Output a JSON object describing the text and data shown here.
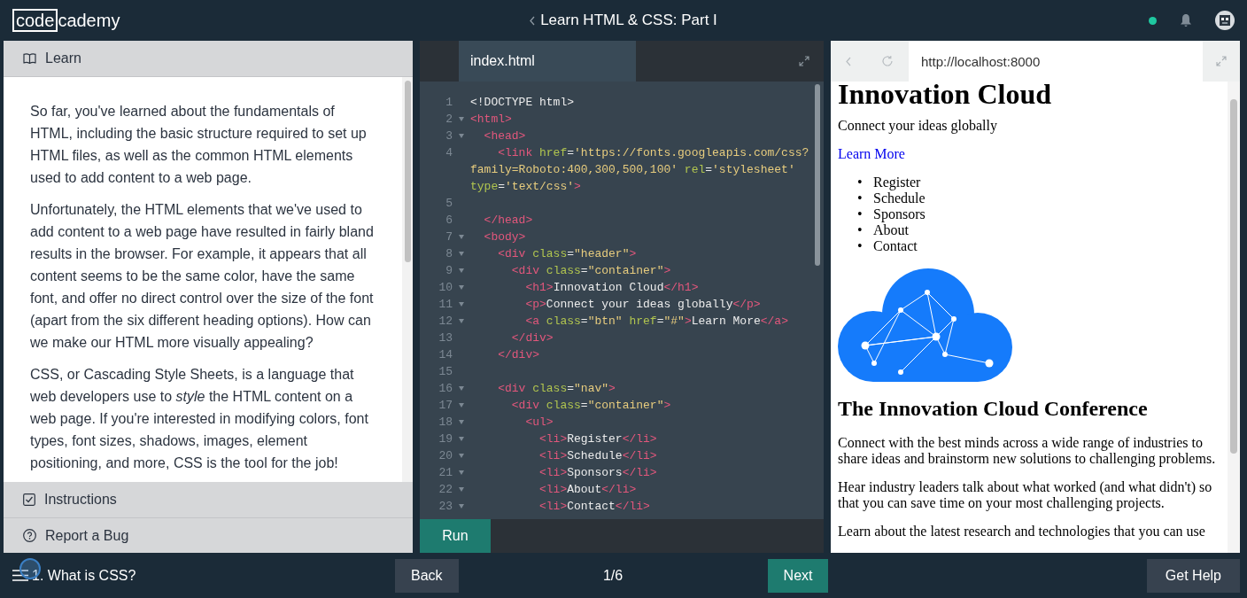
{
  "header": {
    "logo": {
      "boxed": "code",
      "rest": "cademy"
    },
    "course_title": "Learn HTML & CSS: Part I",
    "online": true
  },
  "lesson_panel": {
    "learn_tab": {
      "label": "Learn"
    },
    "paragraphs": [
      "So far, you've learned about the fundamentals of HTML, including the basic structure required to set up HTML files, as well as the common HTML elements used to add content to a web page.",
      "Unfortunately, the HTML elements that we've used to add content to a web page have resulted in fairly bland results in the browser. For example, it appears that all content seems to be the same color, have the same font, and offer no direct control over the size of the font (apart from the six different heading options). How can we make our HTML more visually appealing?",
      "CSS, or Cascading Style Sheets, is a language that web developers use to *style* the HTML content on a web page. If you're interested in modifying colors, font types, font sizes, shadows, images, element positioning, and more, CSS is the tool for the job!"
    ],
    "bottom_tabs": [
      {
        "kind": "instructions",
        "label": "Instructions"
      },
      {
        "kind": "report",
        "label": "Report a Bug"
      }
    ]
  },
  "editor": {
    "file_tab": "index.html",
    "run_button": "Run",
    "lines": [
      {
        "number": "1",
        "foldable": false,
        "tokens": [
          {
            "kind": "text",
            "text": "<!DOCTYPE html>"
          }
        ]
      },
      {
        "number": "2",
        "foldable": true,
        "tokens": [
          {
            "kind": "tag",
            "text": "<html>"
          }
        ]
      },
      {
        "number": "3",
        "foldable": true,
        "tokens": [
          {
            "kind": "tag",
            "text": "  <head>"
          }
        ]
      },
      {
        "number": "4",
        "foldable": false,
        "tokens": [
          {
            "kind": "tag",
            "text": "    <link "
          },
          {
            "kind": "attr",
            "text": "href"
          },
          {
            "kind": "text",
            "text": "="
          },
          {
            "kind": "str",
            "text": "'https://fonts.googleapis.com/css?"
          }
        ],
        "continuation": [
          [
            {
              "kind": "str",
              "text": "family=Roboto:400,300,500,100' "
            },
            {
              "kind": "attr",
              "text": "rel"
            },
            {
              "kind": "text",
              "text": "="
            },
            {
              "kind": "str",
              "text": "'stylesheet'"
            }
          ],
          [
            {
              "kind": "attr",
              "text": "type"
            },
            {
              "kind": "text",
              "text": "="
            },
            {
              "kind": "str",
              "text": "'text/css'"
            },
            {
              "kind": "tag",
              "text": ">"
            }
          ]
        ]
      },
      {
        "number": "5",
        "foldable": false
      },
      {
        "number": "6",
        "foldable": false,
        "tokens": [
          {
            "kind": "tag",
            "text": "  </head>"
          }
        ]
      },
      {
        "number": "7",
        "foldable": true,
        "tokens": [
          {
            "kind": "tag",
            "text": "  <body>"
          }
        ]
      },
      {
        "number": "8",
        "foldable": true,
        "tokens": [
          {
            "kind": "tag",
            "text": "    <div "
          },
          {
            "kind": "attr",
            "text": "class"
          },
          {
            "kind": "text",
            "text": "="
          },
          {
            "kind": "str",
            "text": "\"header\""
          },
          {
            "kind": "tag",
            "text": ">"
          }
        ]
      },
      {
        "number": "9",
        "foldable": true,
        "tokens": [
          {
            "kind": "tag",
            "text": "      <div "
          },
          {
            "kind": "attr",
            "text": "class"
          },
          {
            "kind": "text",
            "text": "="
          },
          {
            "kind": "str",
            "text": "\"container\""
          },
          {
            "kind": "tag",
            "text": ">"
          }
        ]
      },
      {
        "number": "10",
        "foldable": true,
        "tokens": [
          {
            "kind": "tag",
            "text": "        <h1>"
          },
          {
            "kind": "text",
            "text": "Innovation Cloud"
          },
          {
            "kind": "tag",
            "text": "</h1>"
          }
        ]
      },
      {
        "number": "11",
        "foldable": true,
        "tokens": [
          {
            "kind": "tag",
            "text": "        <p>"
          },
          {
            "kind": "text",
            "text": "Connect your ideas globally"
          },
          {
            "kind": "tag",
            "text": "</p>"
          }
        ]
      },
      {
        "number": "12",
        "foldable": true,
        "tokens": [
          {
            "kind": "tag",
            "text": "        <a "
          },
          {
            "kind": "attr",
            "text": "class"
          },
          {
            "kind": "text",
            "text": "="
          },
          {
            "kind": "str",
            "text": "\"btn\" "
          },
          {
            "kind": "attr",
            "text": "href"
          },
          {
            "kind": "text",
            "text": "="
          },
          {
            "kind": "str",
            "text": "\"#\""
          },
          {
            "kind": "tag",
            "text": ">"
          },
          {
            "kind": "text",
            "text": "Learn More"
          },
          {
            "kind": "tag",
            "text": "</a>"
          }
        ]
      },
      {
        "number": "13",
        "foldable": false,
        "tokens": [
          {
            "kind": "tag",
            "text": "      </div>"
          }
        ]
      },
      {
        "number": "14",
        "foldable": false,
        "tokens": [
          {
            "kind": "tag",
            "text": "    </div>"
          }
        ]
      },
      {
        "number": "15",
        "foldable": false
      },
      {
        "number": "16",
        "foldable": true,
        "tokens": [
          {
            "kind": "tag",
            "text": "    <div "
          },
          {
            "kind": "attr",
            "text": "class"
          },
          {
            "kind": "text",
            "text": "="
          },
          {
            "kind": "str",
            "text": "\"nav\""
          },
          {
            "kind": "tag",
            "text": ">"
          }
        ]
      },
      {
        "number": "17",
        "foldable": true,
        "tokens": [
          {
            "kind": "tag",
            "text": "      <div "
          },
          {
            "kind": "attr",
            "text": "class"
          },
          {
            "kind": "text",
            "text": "="
          },
          {
            "kind": "str",
            "text": "\"container\""
          },
          {
            "kind": "tag",
            "text": ">"
          }
        ]
      },
      {
        "number": "18",
        "foldable": true,
        "tokens": [
          {
            "kind": "tag",
            "text": "        <ul>"
          }
        ]
      },
      {
        "number": "19",
        "foldable": true,
        "tokens": [
          {
            "kind": "tag",
            "text": "          <li>"
          },
          {
            "kind": "text",
            "text": "Register"
          },
          {
            "kind": "tag",
            "text": "</li>"
          }
        ]
      },
      {
        "number": "20",
        "foldable": true,
        "tokens": [
          {
            "kind": "tag",
            "text": "          <li>"
          },
          {
            "kind": "text",
            "text": "Schedule"
          },
          {
            "kind": "tag",
            "text": "</li>"
          }
        ]
      },
      {
        "number": "21",
        "foldable": true,
        "tokens": [
          {
            "kind": "tag",
            "text": "          <li>"
          },
          {
            "kind": "text",
            "text": "Sponsors"
          },
          {
            "kind": "tag",
            "text": "</li>"
          }
        ]
      },
      {
        "number": "22",
        "foldable": true,
        "tokens": [
          {
            "kind": "tag",
            "text": "          <li>"
          },
          {
            "kind": "text",
            "text": "About"
          },
          {
            "kind": "tag",
            "text": "</li>"
          }
        ]
      },
      {
        "number": "23",
        "foldable": true,
        "tokens": [
          {
            "kind": "tag",
            "text": "          <li>"
          },
          {
            "kind": "text",
            "text": "Contact"
          },
          {
            "kind": "tag",
            "text": "</li>"
          }
        ]
      }
    ]
  },
  "preview": {
    "url": "http://localhost:8000",
    "heading": "Innovation Cloud",
    "tagline": "Connect your ideas globally",
    "link": "Learn More",
    "nav_items": [
      {
        "bullet": "•",
        "label": "Register"
      },
      {
        "bullet": "•",
        "label": "Schedule"
      },
      {
        "bullet": "•",
        "label": "Sponsors"
      },
      {
        "bullet": "•",
        "label": "About"
      },
      {
        "bullet": "•",
        "label": "Contact"
      }
    ],
    "section_heading": "The Innovation Cloud Conference",
    "paragraphs": [
      "Connect with the best minds across a wide range of industries to share ideas and brainstorm new solutions to challenging problems.",
      "Hear industry leaders talk about what worked (and what didn't) so that you can save time on your most challenging projects.",
      "Learn about the latest research and technologies that you can use"
    ]
  },
  "footer": {
    "lesson_title": "1. What is CSS?",
    "back": "Back",
    "progress": "1/6",
    "next": "Next",
    "help": "Get Help"
  }
}
